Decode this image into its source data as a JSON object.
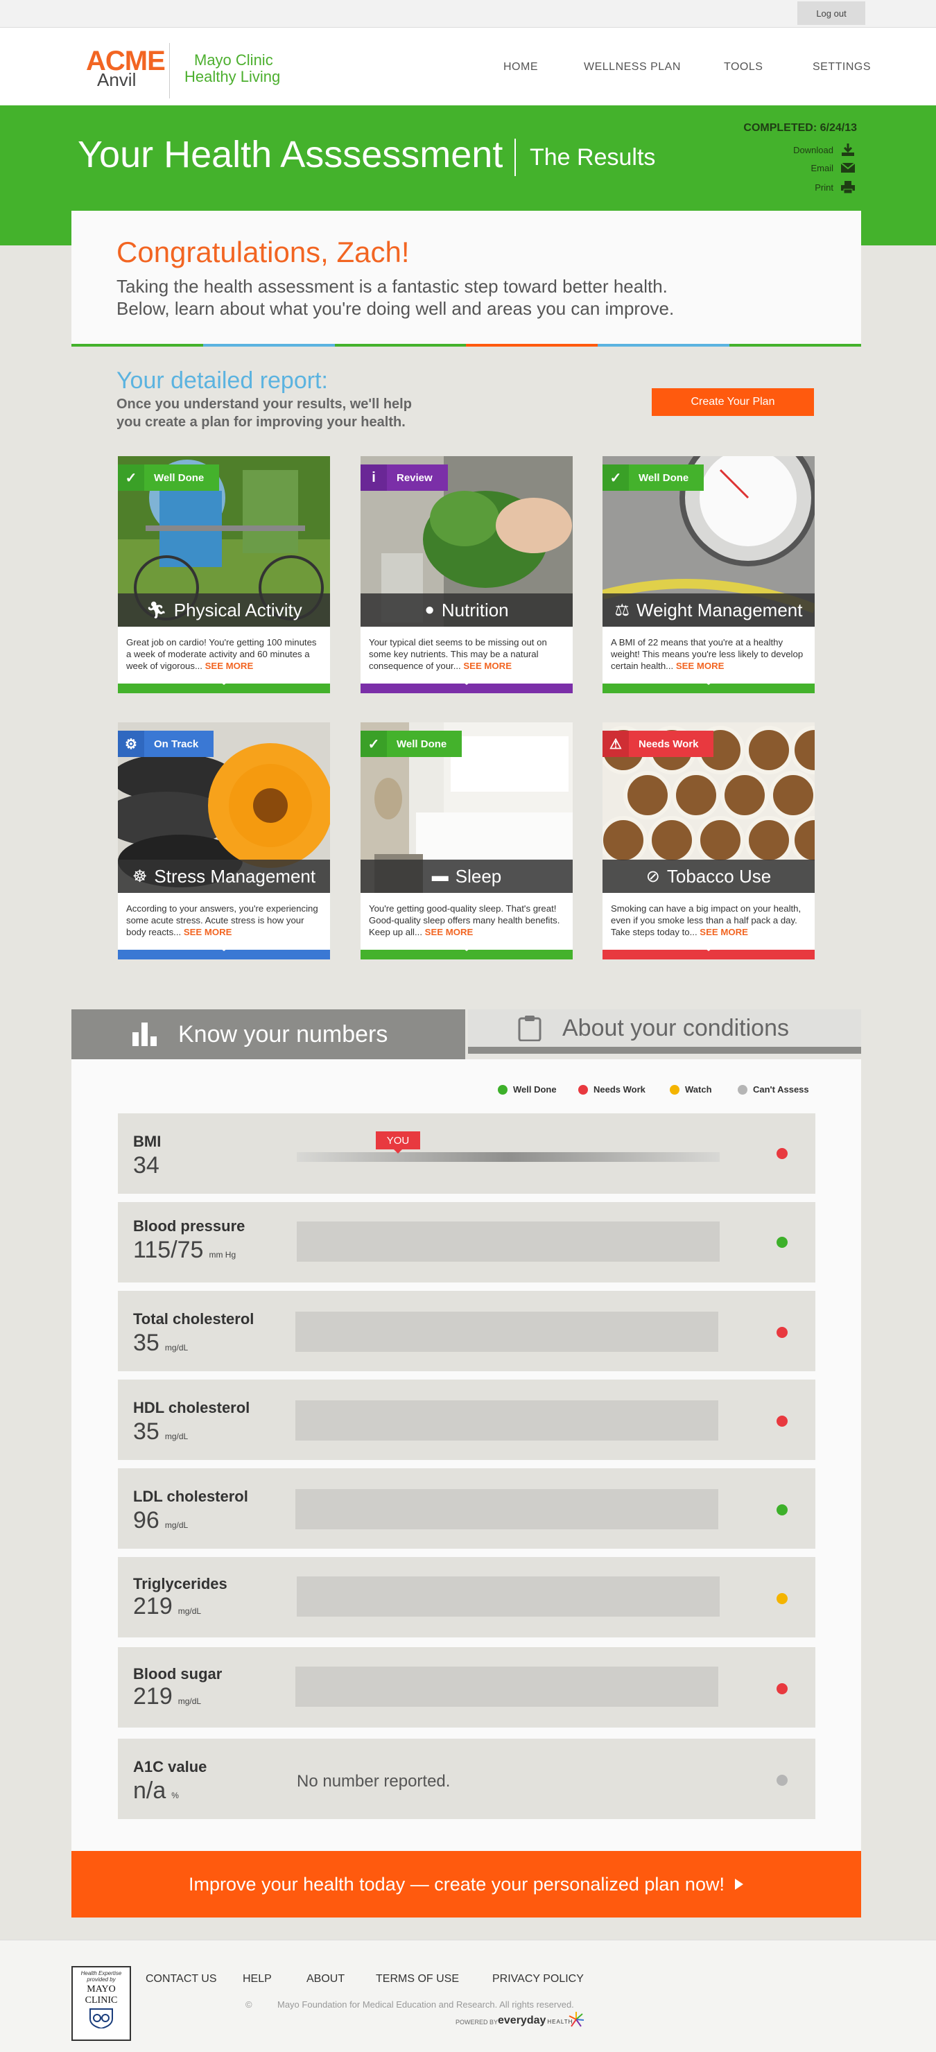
{
  "header": {
    "logout": "Log out",
    "brand_acme": "ACME",
    "brand_anvil": "Anvil",
    "partner_line1": "Mayo Clinic",
    "partner_line2": "Healthy Living",
    "nav": [
      "HOME",
      "WELLNESS PLAN",
      "TOOLS",
      "SETTINGS"
    ]
  },
  "banner": {
    "title": "Your Health Asssessment",
    "subtitle": "The Results",
    "completed": "COMPLETED: 6/24/13",
    "actions": [
      "Download",
      "Email",
      "Print"
    ]
  },
  "intro": {
    "greeting": "Congratulations, Zach!",
    "line1": "Taking the health assessment is a fantastic step toward better health.",
    "line2": "Below, learn about what you're doing well and areas you can improve."
  },
  "report": {
    "heading": "Your detailed report:",
    "sub1": "Once you understand your results, we'll help",
    "sub2": "you create a plan for improving your health.",
    "create_plan": "Create Your Plan"
  },
  "topics": [
    {
      "title": "Physical Activity",
      "badge": "Well Done",
      "status": "well-done",
      "text": "Great job on cardio! You're getting 100 minutes a week of moderate activity and 60 minutes a week of vigorous...",
      "more": "SEE MORE",
      "icon": "running-icon"
    },
    {
      "title": "Nutrition",
      "badge": "Review",
      "status": "review",
      "text": "Your typical diet seems to be missing out on some key nutrients. This may be a natural consequence of your...",
      "more": "SEE MORE",
      "icon": "apple-icon"
    },
    {
      "title": "Weight Management",
      "badge": "Well Done",
      "status": "well-done",
      "text": "A BMI of 22 means that you're at a healthy weight! This means you're less likely to develop certain health...",
      "more": "SEE MORE",
      "icon": "scale-icon"
    },
    {
      "title": "Stress Management",
      "badge": "On Track",
      "status": "on-track",
      "text": "According to your answers, you're experiencing some acute stress. Acute stress is how your body reacts...",
      "more": "SEE MORE",
      "icon": "meditation-icon"
    },
    {
      "title": "Sleep",
      "badge": "Well Done",
      "status": "well-done",
      "text": "You're getting good-quality sleep. That's great! Good-quality sleep offers many health benefits. Keep up all...",
      "more": "SEE MORE",
      "icon": "bed-icon"
    },
    {
      "title": "Tobacco Use",
      "badge": "Needs Work",
      "status": "needs-work",
      "text": "Smoking can have a big impact on your health, even if you smoke less than a half pack a day. Take steps today to...",
      "more": "SEE MORE",
      "icon": "no-smoking-icon"
    }
  ],
  "tabs": {
    "active": "Know your numbers",
    "inactive": "About your conditions"
  },
  "legend": [
    {
      "label": "Well Done",
      "color": "#3db02a"
    },
    {
      "label": "Needs Work",
      "color": "#e8393f"
    },
    {
      "label": "Watch",
      "color": "#f4b400"
    },
    {
      "label": "Can't Assess",
      "color": "#b5b5b5"
    }
  ],
  "numbers": [
    {
      "label": "BMI",
      "value": "34",
      "unit": "",
      "status_color": "#e8393f",
      "marker": "YOU"
    },
    {
      "label": "Blood pressure",
      "value": "115/75",
      "unit": "mm Hg",
      "status_color": "#3db02a"
    },
    {
      "label": "Total cholesterol",
      "value": "35",
      "unit": "mg/dL",
      "status_color": "#e8393f"
    },
    {
      "label": "HDL cholesterol",
      "value": "35",
      "unit": "mg/dL",
      "status_color": "#e8393f"
    },
    {
      "label": "LDL cholesterol",
      "value": "96",
      "unit": "mg/dL",
      "status_color": "#3db02a"
    },
    {
      "label": "Triglycerides",
      "value": "219",
      "unit": "mg/dL",
      "status_color": "#f4b400"
    },
    {
      "label": "Blood sugar",
      "value": "219",
      "unit": "mg/dL",
      "status_color": "#e8393f"
    },
    {
      "label": "A1C value",
      "value": "n/a",
      "unit": "%",
      "status_color": "#b5b5b5",
      "note": "No number reported."
    }
  ],
  "cta": "Improve your health today — create your personalized plan now!",
  "footer": {
    "seal_line1": "Health Expertise",
    "seal_line2": "provided by",
    "seal_line3": "MAYO",
    "seal_line4": "CLINIC",
    "links": [
      "CONTACT US",
      "HELP",
      "ABOUT",
      "TERMS OF USE",
      "PRIVACY POLICY"
    ],
    "copyright_symbol": "©",
    "copyright": "Mayo Foundation for Medical Education and Research. All rights reserved.",
    "powered_by": "POWERED BY",
    "powered_brand": "everyday",
    "powered_brand_small": "HEALTH"
  },
  "colors": {
    "green": "#44b22c",
    "orange": "#ff5a0e",
    "purple": "#7b2fa8",
    "blue": "#3a78d4",
    "red": "#e8393f",
    "light_blue": "#5bb3e0"
  }
}
